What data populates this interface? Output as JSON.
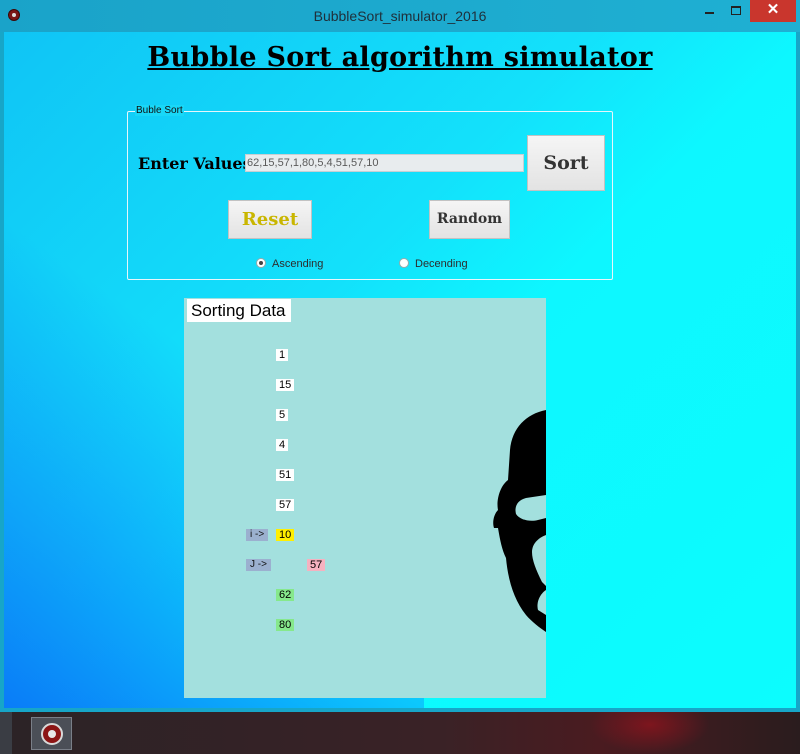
{
  "window": {
    "title": "BubbleSort_simulator_2016"
  },
  "main": {
    "heading": "Bubble Sort algorithm simulator",
    "groupbox": {
      "legend": "Buble Sort",
      "enter_label": "Enter Values",
      "values_input": "62,15,57,1,80,5,4,51,57,10",
      "sort_button": "Sort",
      "reset_button": "Reset",
      "random_button": "Random",
      "radio_ascending": "Ascending",
      "radio_descending": "Decending",
      "selected_order": "Ascending"
    },
    "panel": {
      "title": "Sorting Data",
      "cells": [
        "1",
        "15",
        "5",
        "4",
        "51",
        "57",
        "10",
        "57",
        "62",
        "80"
      ],
      "cell_states": [
        "normal",
        "normal",
        "normal",
        "normal",
        "normal",
        "normal",
        "i",
        "j",
        "sorted",
        "sorted"
      ],
      "pointer_i": "i ->",
      "pointer_j": "J ->"
    }
  },
  "colors": {
    "pointer_i_cell": "#ffef00",
    "pointer_j_cell": "#f5b2c0",
    "sorted_cell": "#86e88c",
    "reset_text": "#c9b600",
    "panel_bg": "#a3e0de"
  }
}
